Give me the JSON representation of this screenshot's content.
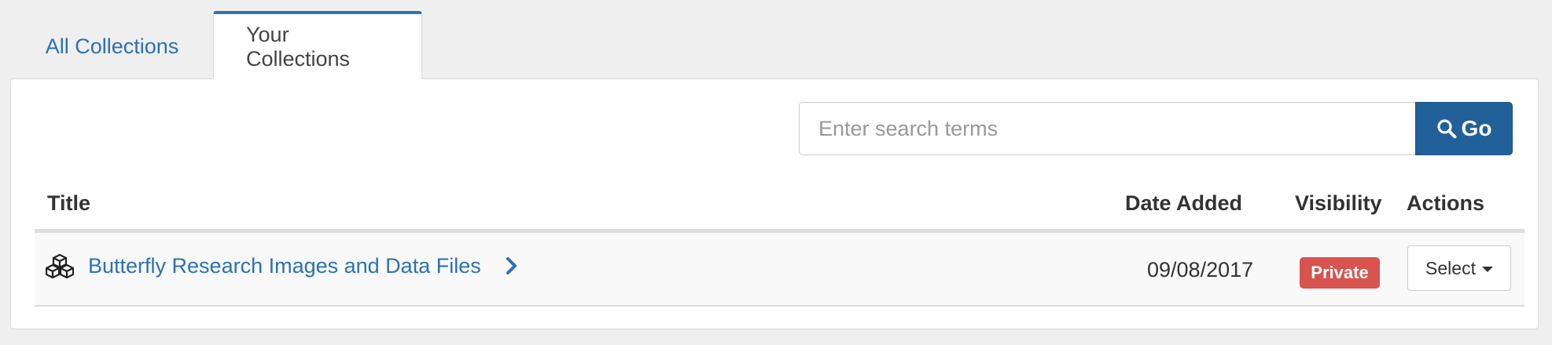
{
  "tabs": {
    "all_label": "All Collections",
    "yours_label": "Your Collections",
    "active": "Your Collections"
  },
  "search": {
    "placeholder": "Enter search terms",
    "value": "",
    "go_label": "Go",
    "go_icon": "search-icon"
  },
  "table": {
    "columns": {
      "title": "Title",
      "date_added": "Date Added",
      "visibility": "Visibility",
      "actions": "Actions"
    },
    "rows": [
      {
        "icon": "cubes-icon",
        "title": "Butterfly Research Images and Data Files",
        "date_added": "09/08/2017",
        "visibility": "Private",
        "action_label": "Select"
      }
    ]
  },
  "colors": {
    "link": "#2a72b5",
    "primary_button": "#22609a",
    "private_badge": "#d9534f"
  }
}
